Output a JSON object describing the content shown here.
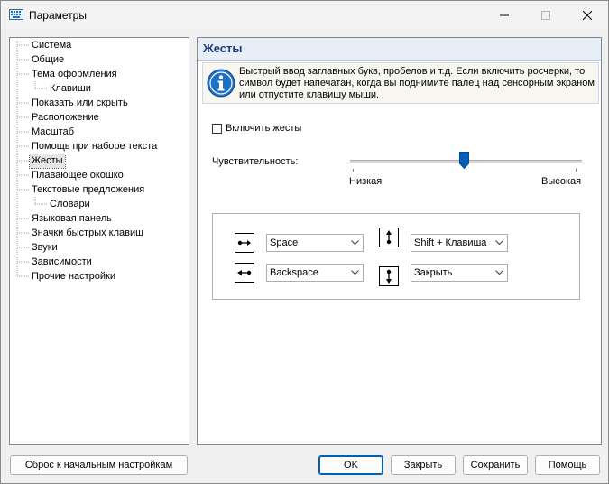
{
  "window": {
    "title": "Параметры"
  },
  "tree": {
    "items": [
      {
        "label": "Система",
        "level": 0
      },
      {
        "label": "Общие",
        "level": 0
      },
      {
        "label": "Тема оформления",
        "level": 0
      },
      {
        "label": "Клавиши",
        "level": 1
      },
      {
        "label": "Показать или скрыть",
        "level": 0
      },
      {
        "label": "Расположение",
        "level": 0
      },
      {
        "label": "Масштаб",
        "level": 0
      },
      {
        "label": "Помощь при наборе текста",
        "level": 0
      },
      {
        "label": "Жесты",
        "level": 0,
        "selected": true
      },
      {
        "label": "Плавающее окошко",
        "level": 0
      },
      {
        "label": "Текстовые предложения",
        "level": 0
      },
      {
        "label": "Словари",
        "level": 1
      },
      {
        "label": "Языковая панель",
        "level": 0
      },
      {
        "label": "Значки быстрых клавиш",
        "level": 0
      },
      {
        "label": "Звуки",
        "level": 0
      },
      {
        "label": "Зависимости",
        "level": 0
      },
      {
        "label": "Прочие настройки",
        "level": 0
      }
    ]
  },
  "panel": {
    "title": "Жесты",
    "info_text": "Быстрый ввод заглавных букв, пробелов и т.д. Если включить росчерки, то символ будет напечатан, когда вы поднимите палец над сенсорным экраном или отпустите клавишу мыши.",
    "enable_gestures_label": "Включить жесты",
    "enable_gestures_checked": false,
    "sensitivity_label": "Чувствительность:",
    "sensitivity_low": "Низкая",
    "sensitivity_high": "Высокая",
    "sensitivity_level": 0.5,
    "gestures": {
      "right": "Space",
      "left": "Backspace",
      "up": "Shift + Клавиша",
      "down": "Закрыть"
    }
  },
  "buttons": {
    "reset": "Сброс к начальным настройкам",
    "ok": "OK",
    "close": "Закрыть",
    "save": "Сохранить",
    "help": "Помощь"
  },
  "colors": {
    "accent": "#005fb8",
    "panel_title": "#1e3d78",
    "info_icon": "#1f6fc5"
  }
}
